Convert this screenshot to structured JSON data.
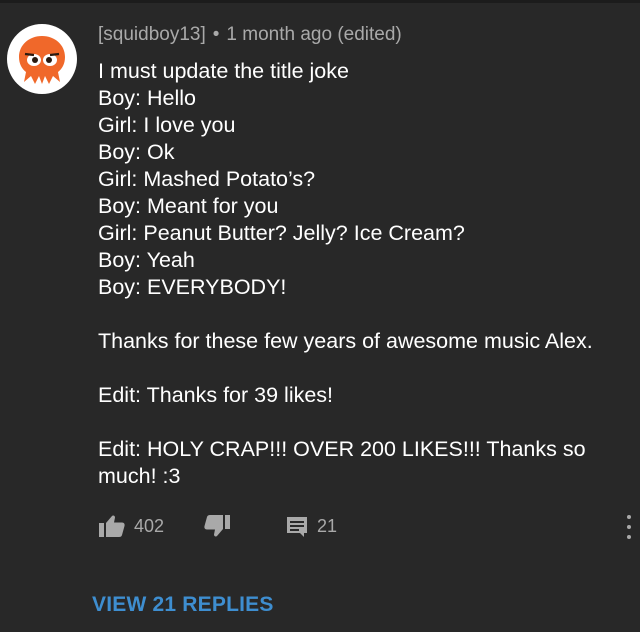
{
  "comment": {
    "author": "[squidboy13]",
    "separator": "•",
    "timestamp": "1 month ago (edited)",
    "lines": [
      "I must update the title joke",
      "Boy: Hello",
      "Girl: I love you",
      "Boy: Ok",
      "Girl: Mashed Potato’s?",
      "Boy: Meant for you",
      "Girl: Peanut Butter? Jelly? Ice Cream?",
      "Boy: Yeah",
      "Boy: EVERYBODY!"
    ],
    "thanks": "Thanks for these few years of awesome music Alex.",
    "edit1": "Edit: Thanks for 39 likes!",
    "edit2": "Edit: HOLY CRAP!!! OVER 200 LIKES!!! Thanks so much! :3",
    "likes": "402",
    "replies_count": "21",
    "view_replies": "VIEW 21 REPLIES"
  },
  "icons": {
    "avatar": "squid-avatar-icon",
    "like": "thumbs-up-icon",
    "dislike": "thumbs-down-icon",
    "reply": "comment-icon",
    "more": "more-vertical-icon"
  },
  "colors": {
    "background": "#282828",
    "text": "#ffffff",
    "meta": "#a9a9a9",
    "link": "#3e8ed0",
    "avatar_bg": "#ffffff",
    "squid": "#f0682a"
  }
}
